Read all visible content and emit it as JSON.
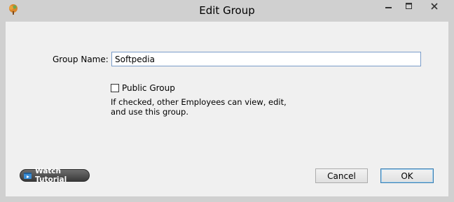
{
  "window": {
    "title": "Edit Group",
    "app_icon": "tree-icon",
    "controls": {
      "minimize": "minimize-icon",
      "maximize": "maximize-icon",
      "close": "close-icon"
    }
  },
  "form": {
    "group_name_label": "Group Name:",
    "group_name_value": "Softpedia",
    "public_group_label": "Public Group",
    "public_group_checked": false,
    "public_group_hint": "If checked, other Employees can view, edit, and use this group."
  },
  "footer": {
    "watch_tutorial_label": "Watch Tutorial",
    "watch_tutorial_icon": "film-icon",
    "cancel_label": "Cancel",
    "ok_label": "OK"
  }
}
